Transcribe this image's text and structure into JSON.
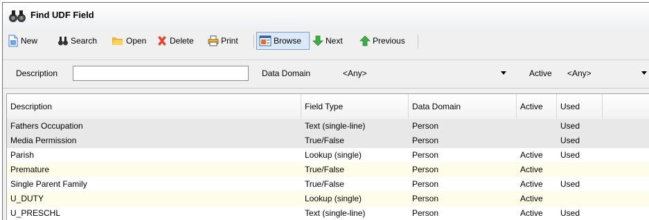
{
  "window": {
    "title": "Find UDF Field"
  },
  "toolbar": {
    "new": "New",
    "search": "Search",
    "open": "Open",
    "delete": "Delete",
    "print": "Print",
    "browse": "Browse",
    "next": "Next",
    "previous": "Previous"
  },
  "filters": {
    "description_label": "Description",
    "description_value": "",
    "data_domain_label": "Data Domain",
    "data_domain_value": "<Any>",
    "active_label": "Active",
    "active_value": "<Any>"
  },
  "table": {
    "columns": [
      "Description",
      "Field Type",
      "Data Domain",
      "Active",
      "Used"
    ],
    "rows": [
      [
        "Fathers Occupation",
        "Text (single-line)",
        "Person",
        "",
        "Used"
      ],
      [
        "Media Permission",
        "True/False",
        "Person",
        "",
        "Used"
      ],
      [
        "Parish",
        "Lookup (single)",
        "Person",
        "Active",
        "Used"
      ],
      [
        "Premature",
        "True/False",
        "Person",
        "Active",
        ""
      ],
      [
        "Single Parent Family",
        "True/False",
        "Person",
        "Active",
        "Used"
      ],
      [
        "U_DUTY",
        "Lookup (single)",
        "Person",
        "Active",
        ""
      ],
      [
        "U_PRESCHL",
        "Text (single-line)",
        "Person",
        "Active",
        "Used"
      ]
    ]
  },
  "colors": {
    "alt_row": "#fdfde9",
    "selected_row": "#e8e8e8",
    "browse_active": "#dce9f8"
  }
}
